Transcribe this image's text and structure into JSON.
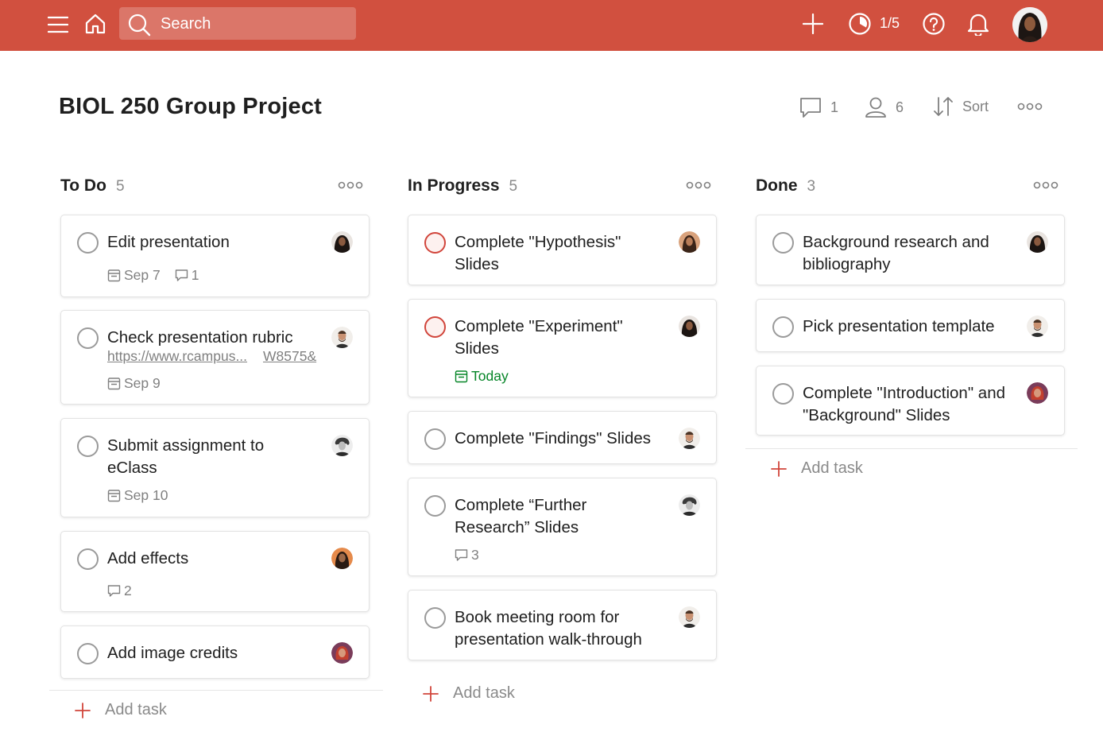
{
  "topbar": {
    "search_placeholder": "Search",
    "karma": "1/5",
    "icons": [
      "menu-icon",
      "home-icon",
      "search-icon",
      "plus-icon",
      "productivity-icon",
      "help-icon",
      "bell-icon"
    ]
  },
  "project": {
    "title": "BIOL 250 Group Project",
    "comments_count": "1",
    "members_count": "6",
    "sort_label": "Sort"
  },
  "columns": [
    {
      "name": "To Do",
      "count": "5",
      "add_label": "Add task",
      "tasks": [
        {
          "title": "Edit presentation",
          "date": "Sep 7",
          "comments": "1"
        },
        {
          "title": "Check presentation rubric",
          "link1": "https://www.rcampus...",
          "link2": "W8575&",
          "date": "Sep 9"
        },
        {
          "title_line1": "Submit assignment to",
          "title_line2": "eClass",
          "date": "Sep 10"
        },
        {
          "title": "Add effects",
          "comments": "2"
        },
        {
          "title": "Add image credits"
        }
      ]
    },
    {
      "name": "In Progress",
      "count": "5",
      "add_label": "Add task",
      "tasks": [
        {
          "title_line1": "Complete \"Hypothesis\"",
          "title_line2": "Slides"
        },
        {
          "title_line1": "Complete \"Experiment\"",
          "title_line2": "Slides",
          "date": "Today"
        },
        {
          "title": "Complete \"Findings\" Slides"
        },
        {
          "title_line1": "Complete “Further",
          "title_line2": "Research” Slides",
          "comments": "3"
        },
        {
          "title_line1": "Book meeting room for",
          "title_line2": "presentation walk-through"
        }
      ]
    },
    {
      "name": "Done",
      "count": "3",
      "add_label": "Add task",
      "tasks": [
        {
          "title_line1": "Background research and",
          "title_line2": "bibliography"
        },
        {
          "title": "Pick presentation template"
        },
        {
          "title_line1": "Complete \"Introduction\" and",
          "title_line2": "\"Background\" Slides"
        }
      ]
    }
  ],
  "colors": {
    "brand": "#d1503f",
    "priority": "#d1453b",
    "today": "#058527",
    "muted": "#808080"
  }
}
